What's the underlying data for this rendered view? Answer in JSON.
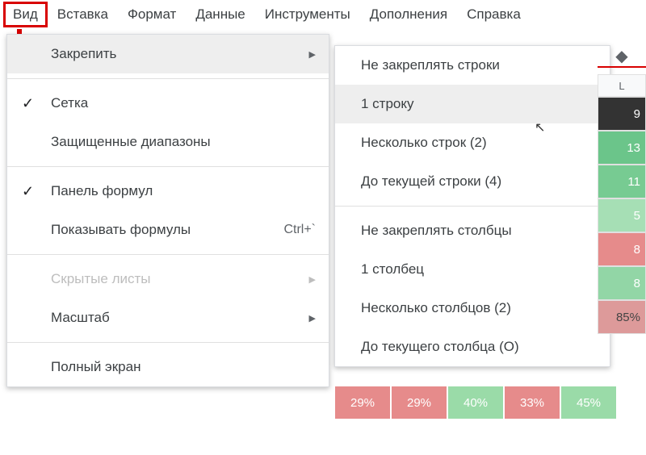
{
  "menubar": {
    "view": "Вид",
    "insert": "Вставка",
    "format": "Формат",
    "data": "Данные",
    "tools": "Инструменты",
    "addons": "Дополнения",
    "help": "Справка"
  },
  "view_menu": {
    "freeze": "Закрепить",
    "gridlines": "Сетка",
    "protected_ranges": "Защищенные диапазоны",
    "formula_bar": "Панель формул",
    "show_formulas": "Показывать формулы",
    "show_formulas_kbd": "Ctrl+`",
    "hidden_sheets": "Скрытые листы",
    "zoom": "Масштаб",
    "fullscreen": "Полный экран"
  },
  "freeze_menu": {
    "no_rows": "Не закреплять строки",
    "one_row": "1 строку",
    "several_rows": "Несколько строк (2)",
    "up_to_row": "До текущей строки (4)",
    "no_cols": "Не закреплять столбцы",
    "one_col": "1 столбец",
    "several_cols": "Несколько столбцов (2)",
    "up_to_col": "До текущего столбца (O)"
  },
  "sheet": {
    "col": "L",
    "cells": [
      "9",
      "13",
      "11",
      "5",
      "8",
      "8",
      "85%"
    ],
    "bottom": [
      "29%",
      "29%",
      "40%",
      "33%",
      "45%"
    ]
  }
}
